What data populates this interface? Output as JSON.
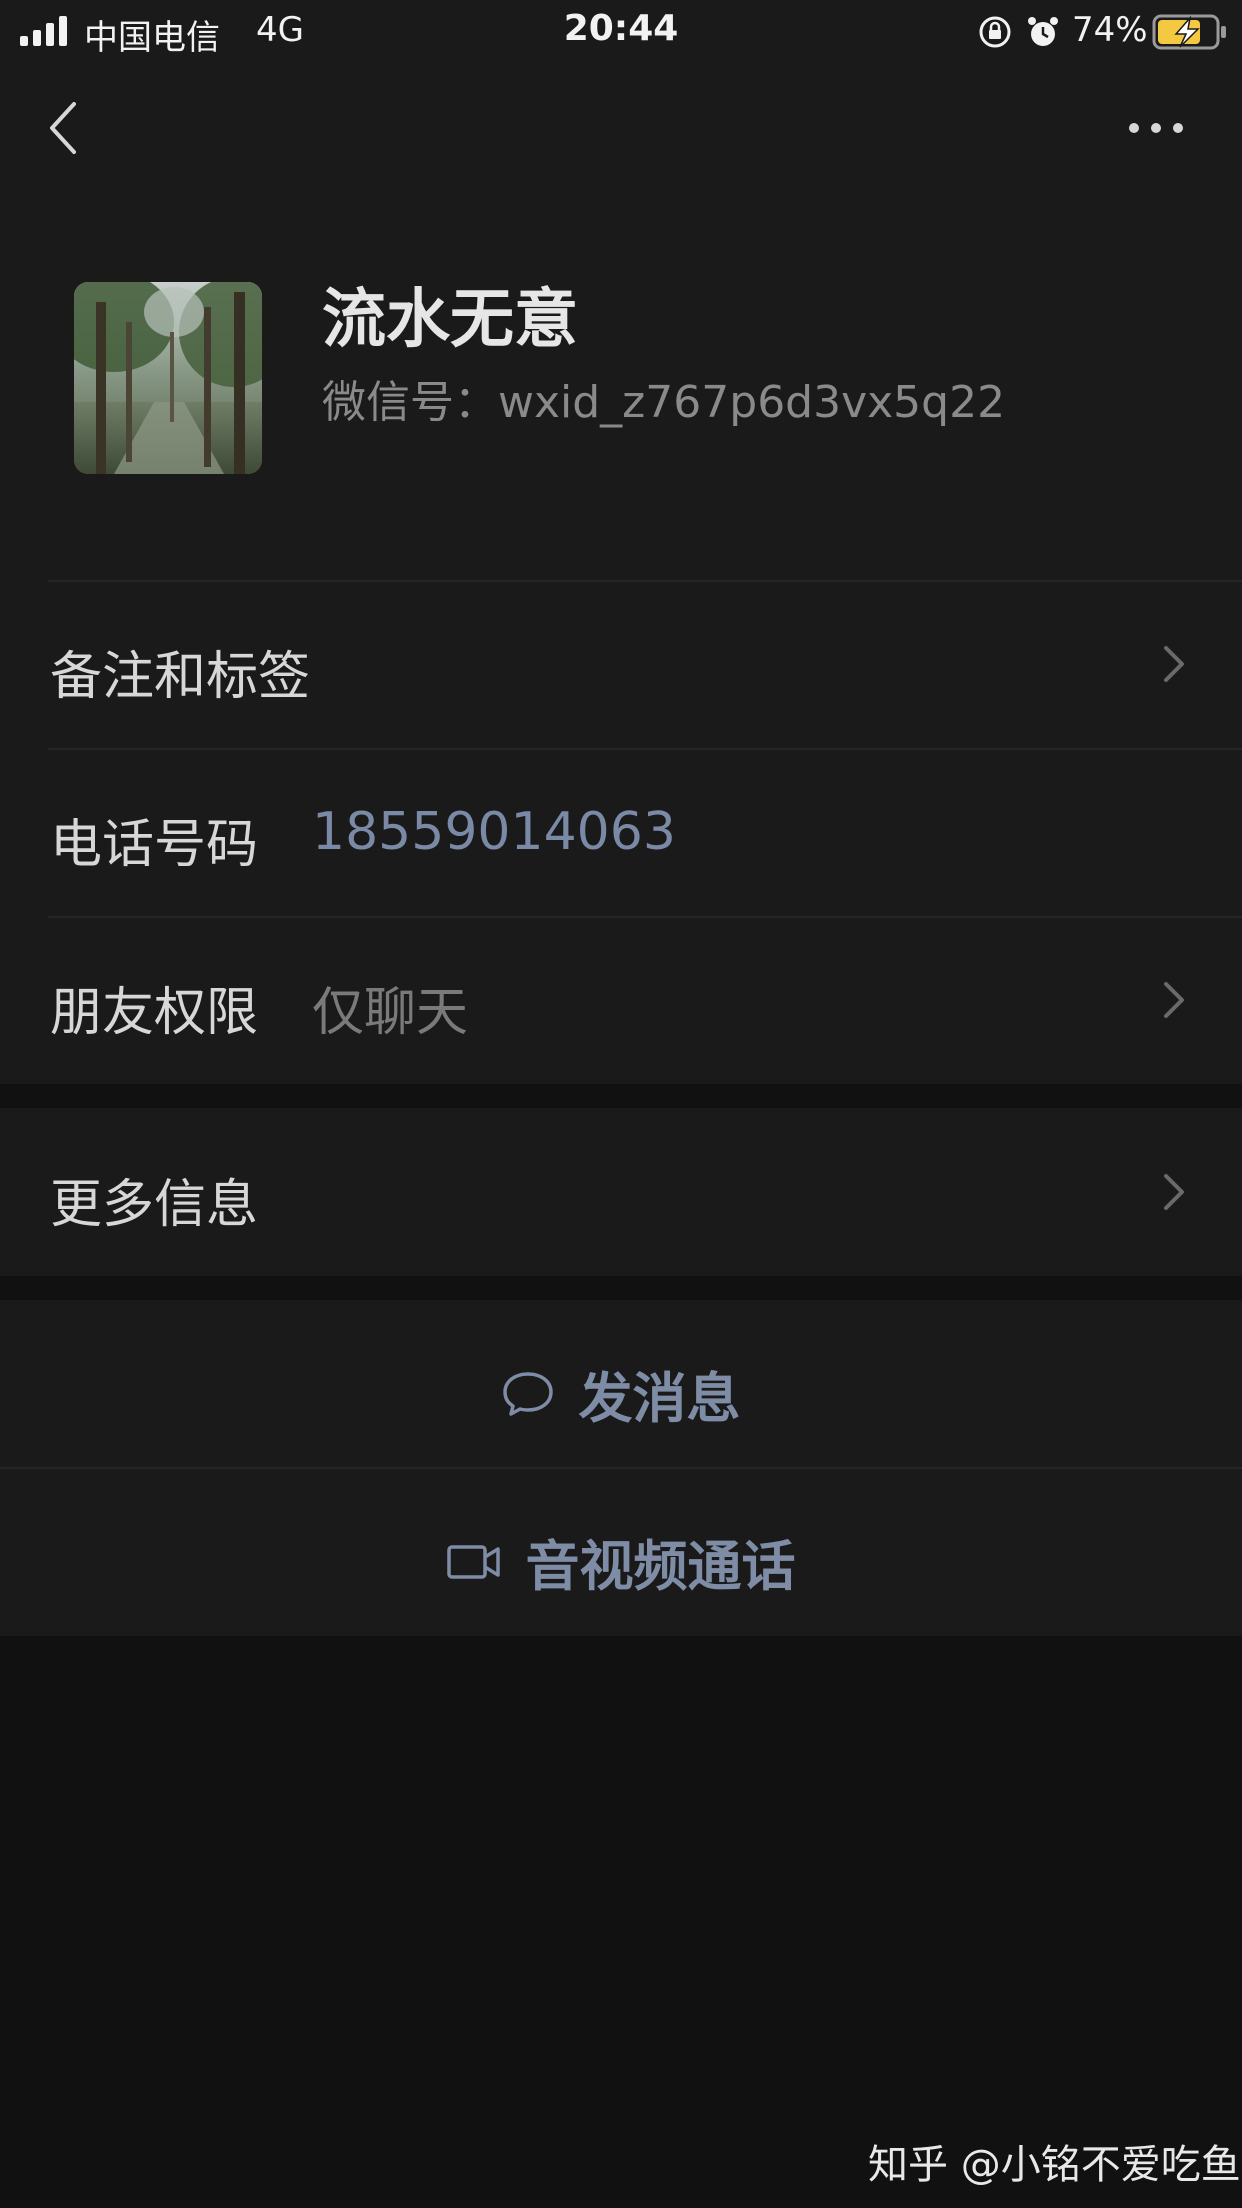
{
  "status_bar": {
    "carrier": "中国电信",
    "network": "4G",
    "time": "20:44",
    "battery_percent": "74%",
    "icons": [
      "signal-icon",
      "orientation-lock-icon",
      "alarm-icon",
      "battery-charging-icon"
    ]
  },
  "nav": {
    "back_icon": "chevron-left-icon",
    "more_icon": "more-dots-icon"
  },
  "profile": {
    "name": "流水无意",
    "wechat_id_label": "微信号：",
    "wechat_id": "wxid_z767p6d3vx5q22"
  },
  "rows": [
    {
      "label": "备注和标签",
      "value": "",
      "has_chevron": true
    },
    {
      "label": "电话号码",
      "value": "18559014063",
      "has_chevron": false
    },
    {
      "label": "朋友权限",
      "value": "仅聊天",
      "has_chevron": true
    }
  ],
  "more_info": {
    "label": "更多信息"
  },
  "actions": {
    "message": {
      "label": "发消息",
      "icon": "chat-bubble-icon"
    },
    "call": {
      "label": "音视频通话",
      "icon": "video-camera-icon"
    }
  },
  "watermark": "知乎 @小铭不爱吃鱼",
  "colors": {
    "background": "#111111",
    "panel": "#1a1a1a",
    "accent_blue": "#7e8ca6",
    "text_primary": "#d7d7d7",
    "text_secondary": "#7a7a7a"
  }
}
